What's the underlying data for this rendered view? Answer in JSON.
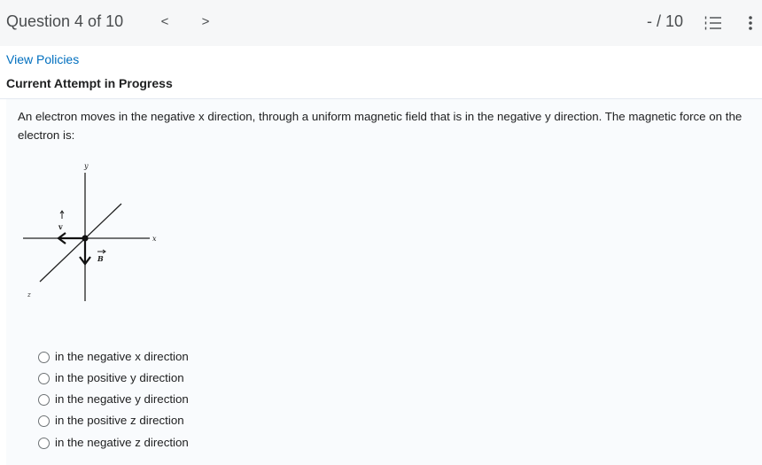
{
  "header": {
    "question_counter": "Question 4 of 10",
    "prev_glyph": "<",
    "next_glyph": ">",
    "score": "- / 10"
  },
  "links": {
    "view_policies": "View Policies"
  },
  "status": {
    "attempt": "Current Attempt in Progress"
  },
  "question": {
    "stem": "An electron moves in the negative x direction, through a uniform magnetic field that is in the negative y direction.  The magnetic force on the electron is:",
    "figure": {
      "y_label": "y",
      "x_label": "x",
      "z_label": "z",
      "v_label": "v",
      "b_label": "B"
    },
    "choices": [
      "in the negative x direction",
      "in the positive y direction",
      "in the negative y direction",
      "in the positive z direction",
      "in the negative z direction"
    ]
  },
  "icons": {
    "prev": "chevron-left-icon",
    "next": "chevron-right-icon",
    "list": "numbered-list-icon",
    "more": "vertical-ellipsis-icon"
  }
}
